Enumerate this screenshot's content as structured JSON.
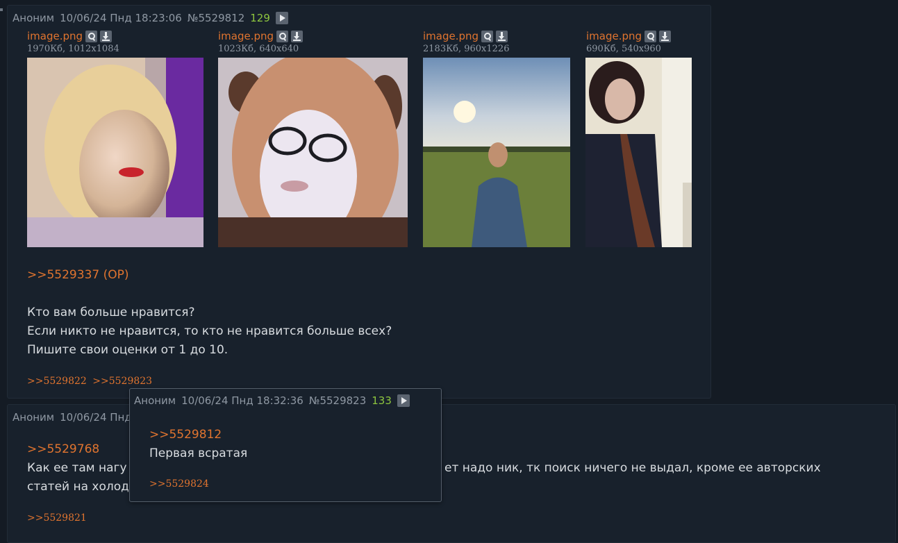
{
  "post1": {
    "author": "Аноним",
    "date": "10/06/24 Пнд 18:23:06",
    "number": "№5529812",
    "count": "129",
    "files": [
      {
        "name": "image.png",
        "meta": "1970Кб, 1012x1084"
      },
      {
        "name": "image.png",
        "meta": "1023Кб, 640x640"
      },
      {
        "name": "image.png",
        "meta": "2183Кб, 960x1226"
      },
      {
        "name": "image.png",
        "meta": "690Кб, 540x960"
      }
    ],
    "reply_to": ">>5529337 (OP)",
    "lines": [
      "Кто вам больше нравится?",
      "Если никто не нравится, то кто не нравится больше всех?",
      "Пишите свои оценки от 1 до 10."
    ],
    "backlinks": [
      ">>5529822",
      ">>5529823"
    ]
  },
  "post2": {
    "author": "Аноним",
    "date": "10/06/24 Пнд",
    "reply_to": ">>5529768",
    "line1_start": "Как ее там нагу",
    "line1_end": "ет надо ник, тк поиск ничего не выдал, кроме ее авторских",
    "line2": "статей на холод",
    "backlinks": [
      ">>5529821"
    ]
  },
  "popup": {
    "author": "Аноним",
    "date": "10/06/24 Пнд 18:32:36",
    "number": "№5529823",
    "count": "133",
    "reply_to": ">>5529812",
    "text": "Первая всратая",
    "backlinks": [
      ">>5529824"
    ]
  },
  "colors": {
    "link": "#e0742f",
    "count": "#8ec63f",
    "post_bg": "#18212c",
    "page_bg": "#141b24"
  }
}
